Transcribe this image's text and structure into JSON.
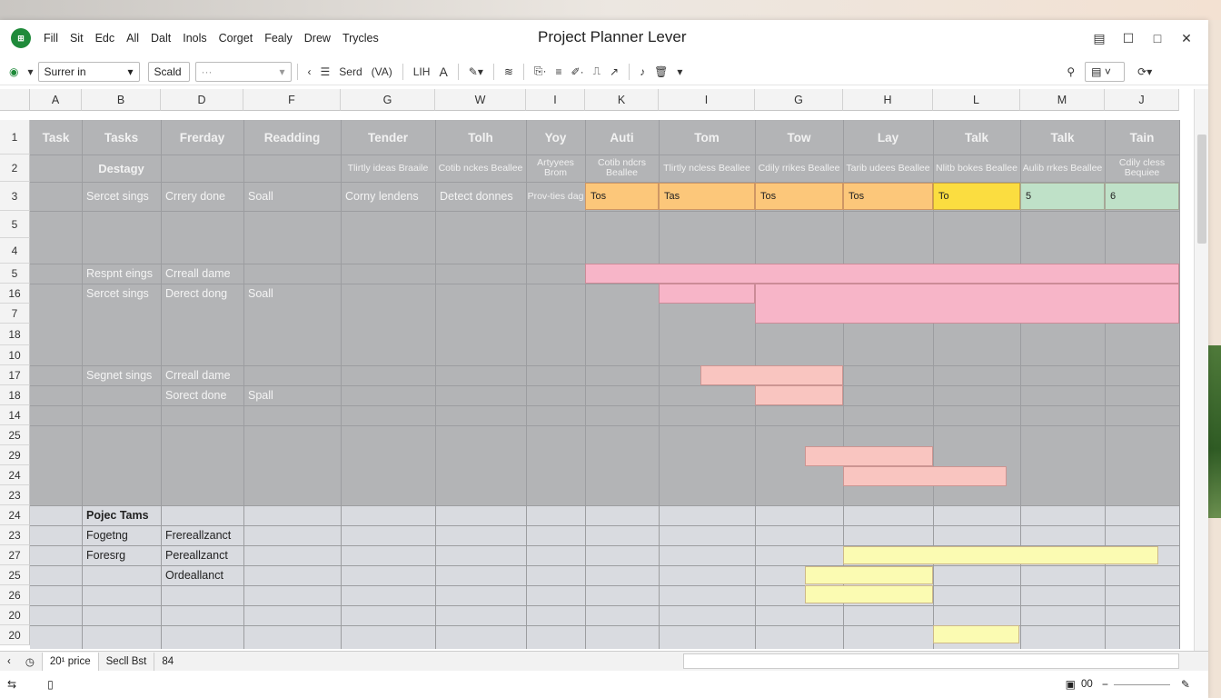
{
  "window": {
    "title": "Project Planner Lever"
  },
  "menu": [
    "Fill",
    "Sit",
    "Edc",
    "All",
    "Dalt",
    "Inols",
    "Corget",
    "Fealy",
    "Drew",
    "Trycles"
  ],
  "toolbar": {
    "font_select": "Surrer in",
    "size_select": "Scald",
    "placeholder_box": "···",
    "label_serd": "Serd",
    "label_va": "(VA)",
    "label_lih": "LIH",
    "label_a": "A"
  },
  "columns": [
    "A",
    "B",
    "D",
    "F",
    "G",
    "W",
    "I",
    "K",
    "I",
    "G",
    "H",
    "L",
    "M",
    "J"
  ],
  "rows": [
    "1",
    "2",
    "3",
    "5",
    "4",
    "5",
    "16",
    "7",
    "18",
    "10",
    "17",
    "18",
    "14",
    "25",
    "29",
    "24",
    "23",
    "24",
    "23",
    "27",
    "25",
    "26",
    "20",
    "20"
  ],
  "header_row": [
    "Task",
    "Tasks",
    "Frerday",
    "Readding",
    "Tender",
    "Tolh",
    "Yoy",
    "Auti",
    "Tom",
    "Tow",
    "Lay",
    "Talk",
    "Talk",
    "Tain"
  ],
  "row2": {
    "b": "Destagy",
    "subs": [
      "Tlirtly ideas Braaile",
      "Cotib nckes Beallee",
      "Artyyees Brom",
      "Cotib ndcrs Beallee",
      "Tlirtly ncless Beallee",
      "Cdily rrikes Beallee",
      "Tarib udees Beallee",
      "Nlitb bokes Beallee",
      "Aulib rrkes Beallee",
      "Cdily cless Bequiee"
    ]
  },
  "row3": {
    "cells": [
      "Sercet sings",
      "Crrery done",
      "Soall",
      "Corny lendens",
      "Detect donnes",
      "Prov-ties dag"
    ],
    "bars": [
      "Tos",
      "Tas",
      "Tos",
      "Tos",
      "To",
      "5",
      "6"
    ]
  },
  "rows_text": {
    "r5_b": "Respnt eings",
    "r5_c": "Crreall dame",
    "r16_b": "Sercet sings",
    "r16_c": "Derect dong",
    "r16_d": "Soall",
    "r17_b": "Segnet sings",
    "r17_c": "Crreall dame",
    "r18_c": "Sorect done",
    "r18_d": "Spall",
    "p24_b": "Pojec Tams",
    "p23_b": "Fogetng",
    "p23_c": "Frereallzanct",
    "p27_b": "Foresrg",
    "p27_c": "Pereallzanct",
    "p25_c": "Ordeallanct"
  },
  "sheet_tabs": {
    "tab1": "20¹ price",
    "tab2": "Secll Bst",
    "tab3": "84"
  },
  "status": {
    "zoom_label": "00"
  },
  "colors": {
    "orange": "#fcc77a",
    "yellow": "#fbdd40",
    "green": "#bfe1c8",
    "pink": "#f7b5c8",
    "salmon": "#f9c5c0",
    "light_yellow": "#fbfbb2"
  }
}
